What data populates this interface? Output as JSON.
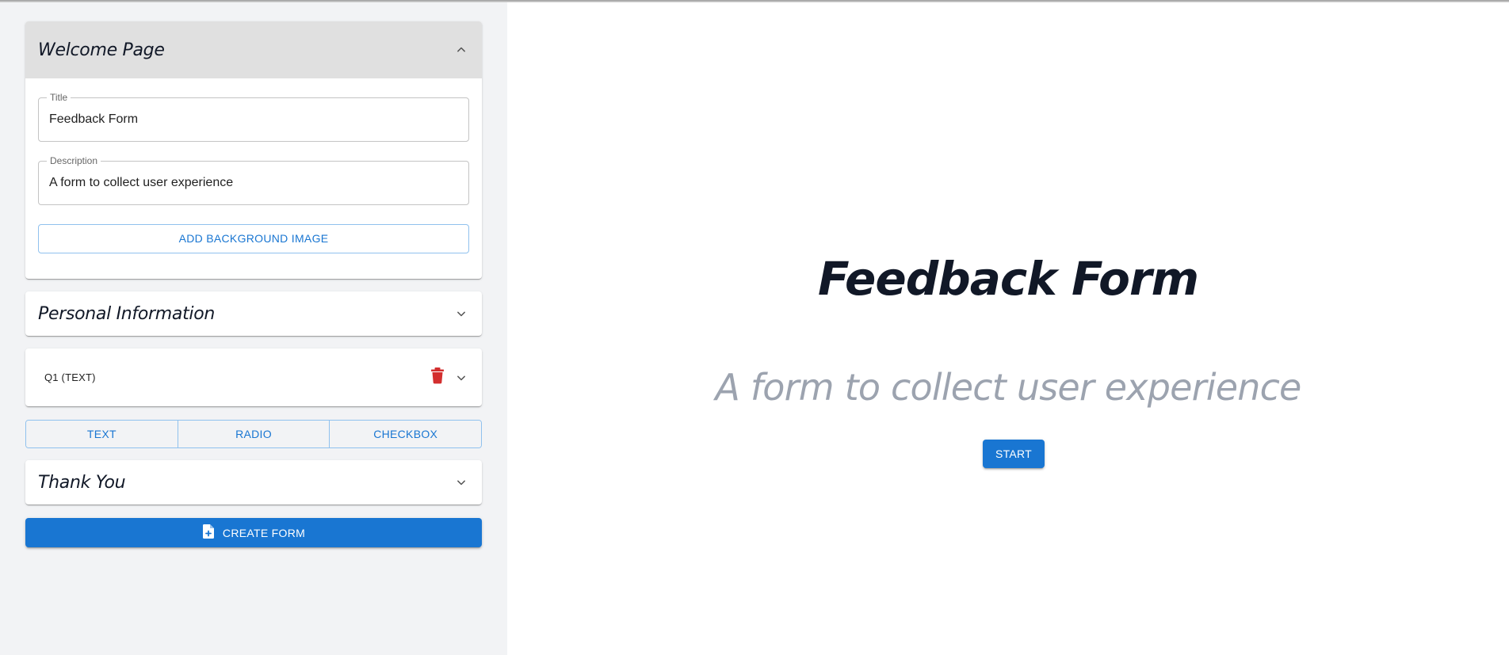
{
  "sidebar": {
    "welcome": {
      "title": "Welcome Page",
      "fields": {
        "title_label": "Title",
        "title_value": "Feedback Form",
        "description_label": "Description",
        "description_value": "A form to collect user experience"
      },
      "add_background_label": "ADD BACKGROUND IMAGE"
    },
    "personal": {
      "title": "Personal Information"
    },
    "question": {
      "label": "Q1 (TEXT)"
    },
    "add_question_types": [
      "TEXT",
      "RADIO",
      "CHECKBOX"
    ],
    "thanks": {
      "title": "Thank You"
    },
    "create_label": "CREATE FORM"
  },
  "preview": {
    "title": "Feedback Form",
    "description": "A form to collect user experience",
    "start_label": "START"
  },
  "colors": {
    "primary": "#1976d2",
    "danger": "#d32f2f",
    "sidebar_bg": "#f2f3f5",
    "title_text": "#111827",
    "muted_text": "#9ca3af"
  },
  "icons": {
    "expanded": "chevron-up-icon",
    "collapsed": "chevron-down-icon",
    "delete": "trash-icon",
    "create": "file-add-icon"
  }
}
